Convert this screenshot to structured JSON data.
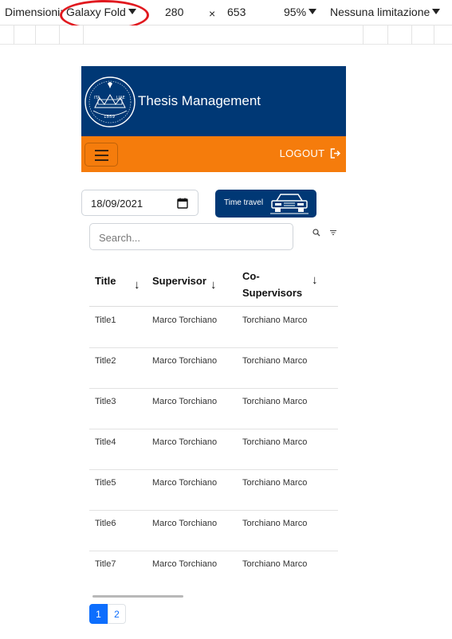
{
  "devtools": {
    "dimensions_label": "Dimensioni",
    "device_name": "Galaxy Fold",
    "width": "280",
    "times": "×",
    "height": "653",
    "zoom": "95%",
    "throttling": "Nessuna limitazione",
    "annotation_color": "#e1191f"
  },
  "app": {
    "title": "Thesis Management",
    "header_color": "#003875",
    "navbar_color": "#f57c0c",
    "logout_label": "LOGOUT",
    "logo": {
      "arc_text": "ITA",
      "arc_text_right": "LIAE",
      "year": "1859"
    }
  },
  "controls": {
    "date_value": "18/09/2021",
    "time_travel_label": "Time travel",
    "search_placeholder": "Search..."
  },
  "table": {
    "columns": [
      {
        "label": "Title"
      },
      {
        "label": "Supervisor"
      },
      {
        "label_line1": "Co-",
        "label_line2": "Supervisors"
      }
    ],
    "sort_glyph": "↓",
    "rows": [
      {
        "title": "Title1",
        "supervisor": "Marco Torchiano",
        "co": "Torchiano Marco"
      },
      {
        "title": "Title2",
        "supervisor": "Marco Torchiano",
        "co": "Torchiano Marco"
      },
      {
        "title": "Title3",
        "supervisor": "Marco Torchiano",
        "co": "Torchiano Marco"
      },
      {
        "title": "Title4",
        "supervisor": "Marco Torchiano",
        "co": "Torchiano Marco"
      },
      {
        "title": "Title5",
        "supervisor": "Marco Torchiano",
        "co": "Torchiano Marco"
      },
      {
        "title": "Title6",
        "supervisor": "Marco Torchiano",
        "co": "Torchiano Marco"
      },
      {
        "title": "Title7",
        "supervisor": "Marco Torchiano",
        "co": "Torchiano Marco"
      }
    ]
  },
  "pagination": {
    "pages": [
      "1",
      "2"
    ],
    "current": "1"
  }
}
